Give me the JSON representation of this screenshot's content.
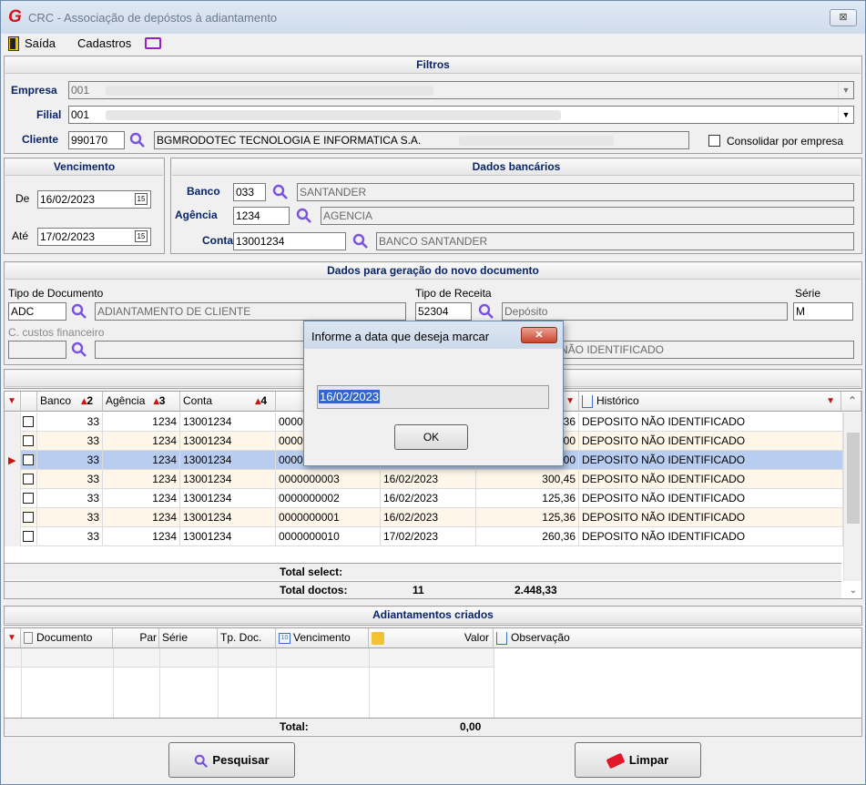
{
  "window": {
    "title": "CRC - Associação de depóstos à adiantamento",
    "close": "⊠"
  },
  "menu": {
    "exit": "Saída",
    "register": "Cadastros"
  },
  "filters": {
    "header": "Filtros",
    "empresa_label": "Empresa",
    "empresa_value": "001",
    "filial_label": "Filial",
    "filial_value": "001",
    "cliente_label": "Cliente",
    "cliente_code": "990170",
    "cliente_name": "BGMRODOTEC TECNOLOGIA E INFORMATICA S.A.",
    "consolidar_label": "Consolidar por empresa"
  },
  "vencimento": {
    "header": "Vencimento",
    "de_label": "De",
    "de_value": "16/02/2023",
    "ate_label": "Até",
    "ate_value": "17/02/2023"
  },
  "bank": {
    "header": "Dados bancários",
    "banco_label": "Banco",
    "banco_code": "033",
    "banco_name": "SANTANDER",
    "agencia_label": "Agência",
    "agencia_code": "1234",
    "agencia_name": "AGENCIA",
    "conta_label": "Conta",
    "conta_code": "13001234",
    "conta_name": "BANCO SANTANDER"
  },
  "newdoc": {
    "header": "Dados para geração do novo documento",
    "tipo_doc_label": "Tipo de Documento",
    "tipo_doc_code": "ADC",
    "tipo_doc_name": "ADIANTAMENTO DE CLIENTE",
    "tipo_receita_label": "Tipo de Receita",
    "tipo_receita_code": "52304",
    "tipo_receita_name": "Depósito",
    "serie_label": "Série",
    "serie_value": "M",
    "ccustos_label": "C. custos financeiro",
    "historico_value": "NÃO IDENTIFICADO"
  },
  "deposits": {
    "columns": {
      "banco": "Banco",
      "banco_sort": "2",
      "agencia": "Agência",
      "agencia_sort": "3",
      "conta": "Conta",
      "conta_sort": "4",
      "historico": "Histórico"
    },
    "rows": [
      {
        "banco": "33",
        "agencia": "1234",
        "conta": "13001234",
        "doc": "0000",
        "data": "",
        "valor": "36",
        "hist": "DEPOSITO NÃO IDENTIFICADO"
      },
      {
        "banco": "33",
        "agencia": "1234",
        "conta": "13001234",
        "doc": "0000",
        "data": "",
        "valor": "00",
        "hist": "DEPOSITO NÃO IDENTIFICADO"
      },
      {
        "banco": "33",
        "agencia": "1234",
        "conta": "13001234",
        "doc": "0000",
        "data": "",
        "valor": "00",
        "hist": "DEPOSITO NÃO IDENTIFICADO"
      },
      {
        "banco": "33",
        "agencia": "1234",
        "conta": "13001234",
        "doc": "0000000003",
        "data": "16/02/2023",
        "valor": "300,45",
        "hist": "DEPOSITO NÃO IDENTIFICADO"
      },
      {
        "banco": "33",
        "agencia": "1234",
        "conta": "13001234",
        "doc": "0000000002",
        "data": "16/02/2023",
        "valor": "125,36",
        "hist": "DEPOSITO NÃO IDENTIFICADO"
      },
      {
        "banco": "33",
        "agencia": "1234",
        "conta": "13001234",
        "doc": "0000000001",
        "data": "16/02/2023",
        "valor": "125,36",
        "hist": "DEPOSITO NÃO IDENTIFICADO"
      },
      {
        "banco": "33",
        "agencia": "1234",
        "conta": "13001234",
        "doc": "0000000010",
        "data": "17/02/2023",
        "valor": "260,36",
        "hist": "DEPOSITO NÃO IDENTIFICADO"
      }
    ],
    "total_select_label": "Total select:",
    "total_doctos_label": "Total doctos:",
    "total_doctos_count": "11",
    "total_doctos_value": "2.448,33"
  },
  "advances": {
    "header": "Adiantamentos criados",
    "columns": {
      "documento": "Documento",
      "par": "Par",
      "serie": "Série",
      "tpdoc": "Tp. Doc.",
      "vencimento": "Vencimento",
      "valor": "Valor",
      "observacao": "Observação"
    },
    "total_label": "Total:",
    "total_value": "0,00"
  },
  "buttons": {
    "pesquisar": "Pesquisar",
    "limpar": "Limpar"
  },
  "dialog": {
    "title": "Informe a data que deseja marcar",
    "close": "✕",
    "value": "16/02/2023",
    "ok": "OK"
  },
  "colors": {
    "accent": "#0a246a",
    "selected_row": "#b9cdf0",
    "alt_row": "#fdf6e9",
    "close_red": "#c9452e",
    "sort_red": "#d01010"
  }
}
